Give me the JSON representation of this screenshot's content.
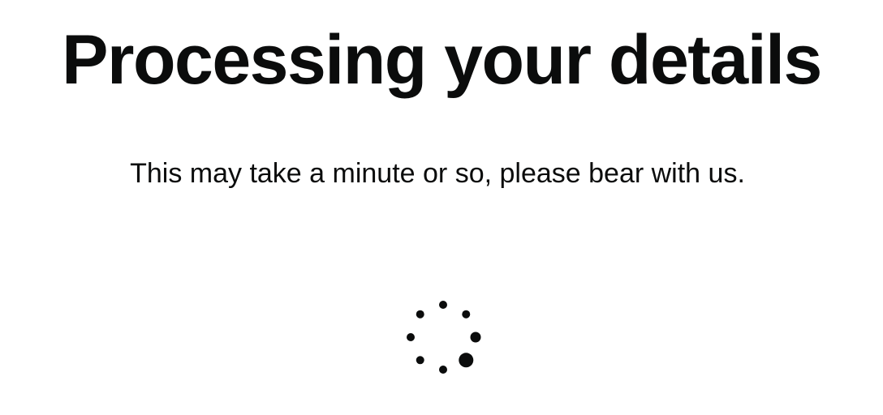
{
  "page": {
    "title": "Processing your details",
    "message": "This may take a minute or so, please bear with us."
  },
  "spinner": {
    "icon": "loading-spinner-icon",
    "color": "#0b0c0c",
    "dots": 8
  },
  "colors": {
    "text": "#0b0c0c",
    "background": "#ffffff"
  }
}
